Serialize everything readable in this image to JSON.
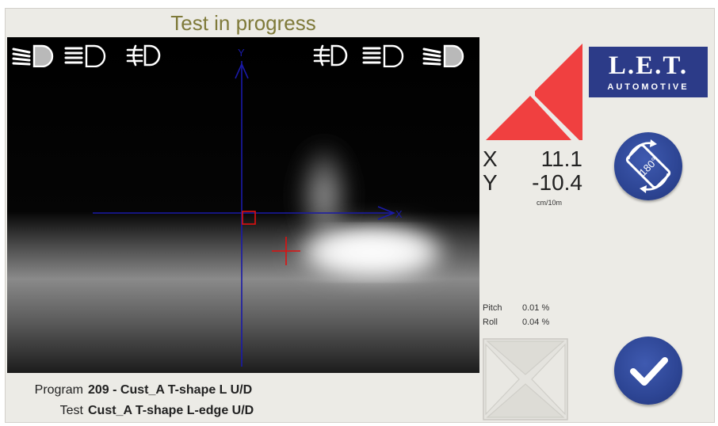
{
  "title": "Test in progress",
  "readout": {
    "x_label": "X",
    "x_value": "11.1",
    "y_label": "Y",
    "y_value": "-10.4",
    "unit": "cm/10m"
  },
  "axes": {
    "x_label": "X",
    "y_label": "Y"
  },
  "tilt": {
    "pitch_label": "Pitch",
    "pitch_value": "0.01 %",
    "roll_label": "Roll",
    "roll_value": "0.04 %"
  },
  "program": {
    "program_label": "Program",
    "program_value": "209 - Cust_A T-shape L U/D",
    "test_label": "Test",
    "test_value": "Cust_A T-shape L-edge U/D"
  },
  "logo": {
    "line1": "L.E.T.",
    "line2": "AUTOMOTIVE"
  },
  "rotate_button": {
    "text": "180°"
  },
  "colors": {
    "title": "#7f7a3a",
    "arrow": "#f04040",
    "button": "#2d4594",
    "axis": "#1a1aa8",
    "target": "#e01010"
  },
  "icons": {
    "left": [
      "low-beam-icon",
      "high-beam-icon",
      "fog-light-icon"
    ],
    "right": [
      "fog-light-icon",
      "high-beam-icon",
      "low-beam-icon"
    ],
    "actions": [
      "rotate-180-icon",
      "checkmark-icon"
    ]
  }
}
